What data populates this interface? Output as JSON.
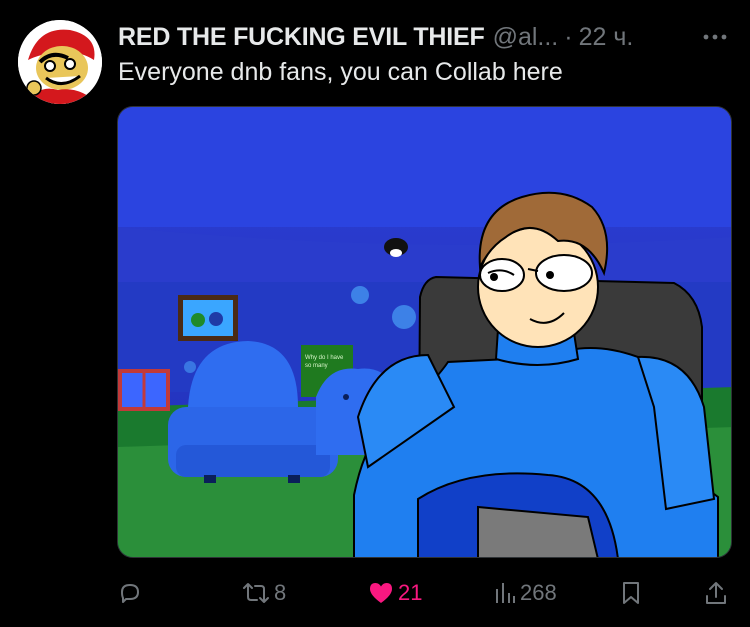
{
  "tweet": {
    "author_name": "RED THE FUCKING EVIL THIEF",
    "handle": "@al...",
    "separator": "·",
    "time": "22 ч.",
    "text": "Everyone dnb fans, you can Collab here"
  },
  "media": {
    "poster_text": "Why do I have so many"
  },
  "actions": {
    "reply_count": "",
    "retweet_count": "8",
    "like_count": "21",
    "views_count": "268"
  },
  "colors": {
    "like": "#f91880",
    "muted": "#71767b",
    "text": "#e7e9ea",
    "background": "#000000"
  },
  "icons": [
    "more-icon",
    "reply-icon",
    "retweet-icon",
    "heart-icon",
    "views-icon",
    "bookmark-icon",
    "share-icon"
  ]
}
